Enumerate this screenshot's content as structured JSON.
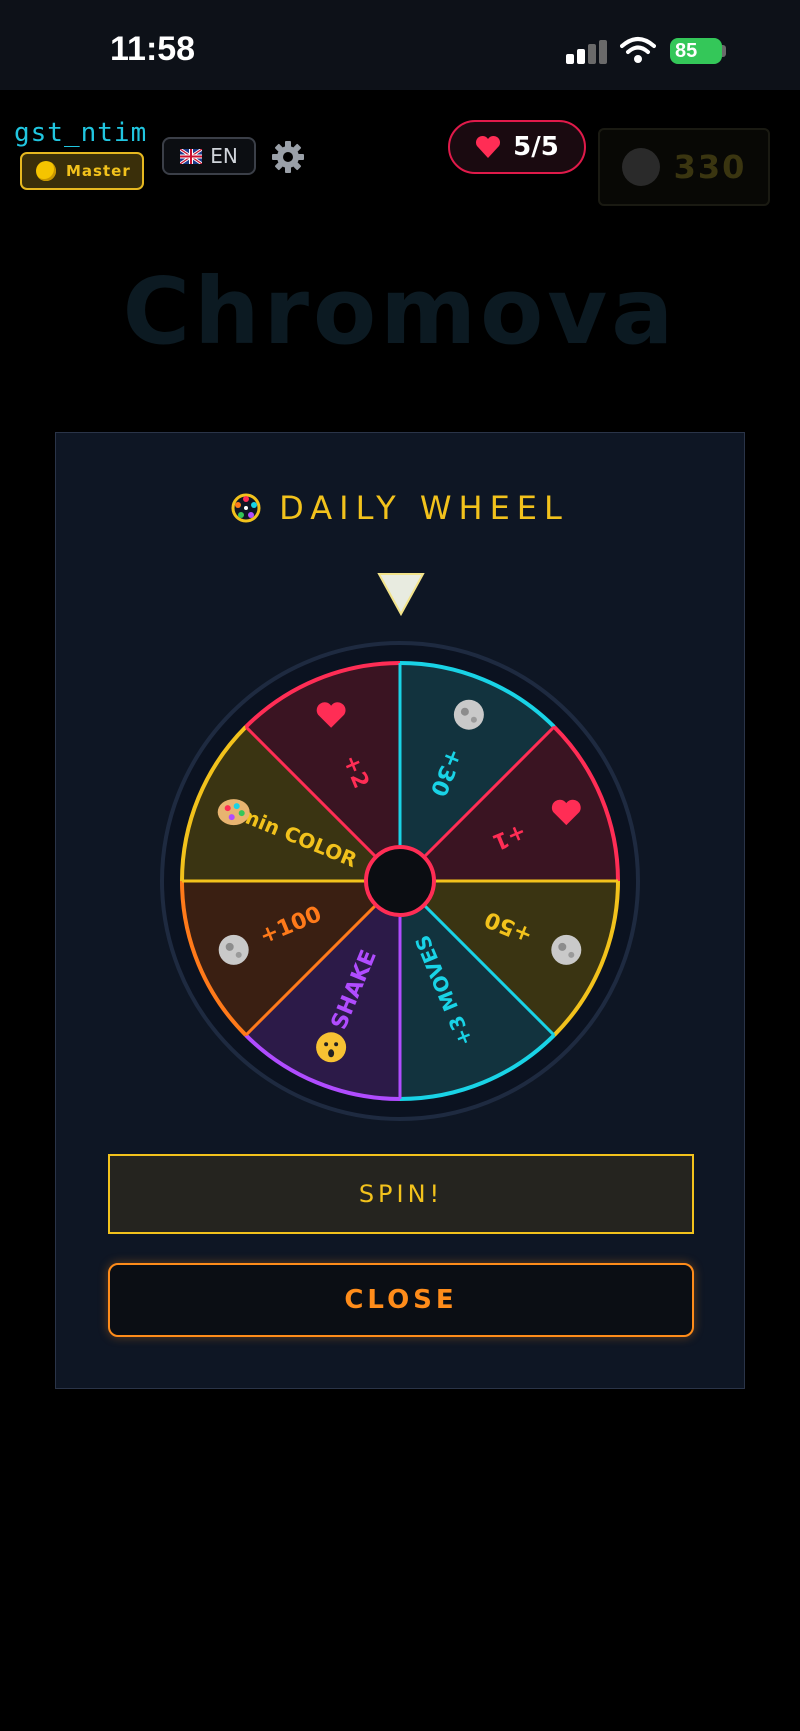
{
  "status_bar": {
    "time": "11:58",
    "battery": "85",
    "icons": [
      "signal-icon",
      "wifi-icon",
      "battery-icon"
    ]
  },
  "header": {
    "username": "gst_ntim",
    "rank": "Master",
    "language": "EN",
    "lives": "5/5",
    "coins": "330"
  },
  "background": {
    "title": "Chromova",
    "subtitle": "",
    "footer": ""
  },
  "modal": {
    "title": "DAILY WHEEL",
    "spin_label": "SPIN!",
    "close_label": "CLOSE",
    "segments": [
      {
        "label": "+30",
        "icon": "moon-icon",
        "color": "#19d3e6",
        "fill": "#12333e"
      },
      {
        "label": "+1",
        "icon": "heart-icon",
        "color": "#ff2d55",
        "fill": "#3a1422"
      },
      {
        "label": "+50",
        "icon": "moon-icon",
        "color": "#f2c21c",
        "fill": "#3a3412"
      },
      {
        "label": "+3 MOVES",
        "icon": "",
        "color": "#19d3e6",
        "fill": "#12333e"
      },
      {
        "label": "SHAKE",
        "icon": "shake-face-icon",
        "color": "#b04cff",
        "fill": "#2c1a48"
      },
      {
        "label": "+100",
        "icon": "moon-icon",
        "color": "#ff7a1a",
        "fill": "#3a1f12"
      },
      {
        "label": "2min COLOR",
        "icon": "palette-icon",
        "color": "#f2c21c",
        "fill": "#3a3412"
      },
      {
        "label": "+2",
        "icon": "heart-icon",
        "color": "#ff2d55",
        "fill": "#3a1422"
      }
    ]
  },
  "colors": {
    "accent_yellow": "#f2c21c",
    "accent_orange": "#ff8c1a",
    "accent_cyan": "#21c6e0",
    "lives_red": "#e01a4a"
  }
}
